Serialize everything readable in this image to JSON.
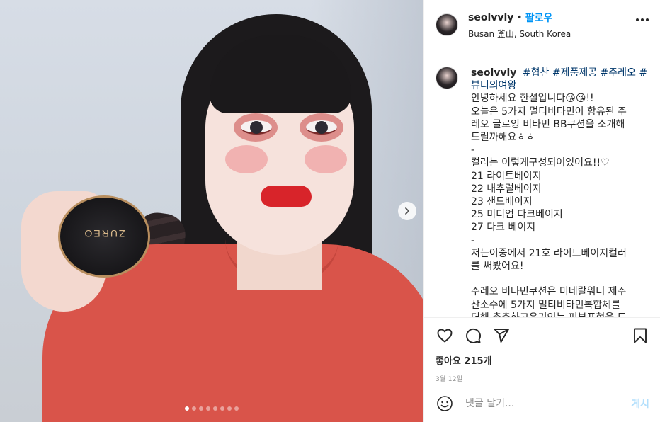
{
  "post": {
    "username": "seolvvly",
    "separator": "•",
    "follow_label": "팔로우",
    "location": "Busan 釜山, South Korea"
  },
  "media": {
    "product_brand": "ZUREO",
    "carousel": {
      "total_slides": 8,
      "active_index": 0
    }
  },
  "caption": {
    "username": "seolvvly",
    "hashtags_line1": [
      "#협찬",
      "#제품제공",
      "#주레오",
      "#"
    ],
    "hashtags_line2": "뷰티의여왕",
    "lines": [
      "안녕하세요 한설입니다😘😘!!",
      "오늘은 5가지 멀티비타민이 함유된 주",
      "레오 글로잉 비타민 BB쿠션을 소개해",
      "드릴까해요ㅎㅎ",
      "-",
      "컬러는 이렇게구성되어있어요!!♡",
      "21 라이트베이지",
      "22 내추럴베이지",
      "23 샌드베이지",
      "25 미디엄 다크베이지",
      "27 다크 베이지",
      "-",
      "저는이중에서 21호 라이트베이지컬러",
      "를 써봤어요!",
      "",
      "주레오 비타민쿠션은 미네랄워터 제주",
      "산소수에 5가지 멀티비타민복합체를",
      "더해 촉촉하고윤기있는 피부표현을 도"
    ]
  },
  "actions": {
    "icons": [
      "heart-icon",
      "comment-icon",
      "share-icon",
      "bookmark-icon"
    ],
    "likes_text": "좋아요 215개",
    "timestamp": "3월 12일"
  },
  "comment_box": {
    "placeholder": "댓글 달기...",
    "post_label": "게시"
  },
  "colors": {
    "link_blue": "#0095f6",
    "hashtag_blue": "#00376b",
    "disabled_post": "#b2dffc",
    "border": "#efefef"
  }
}
